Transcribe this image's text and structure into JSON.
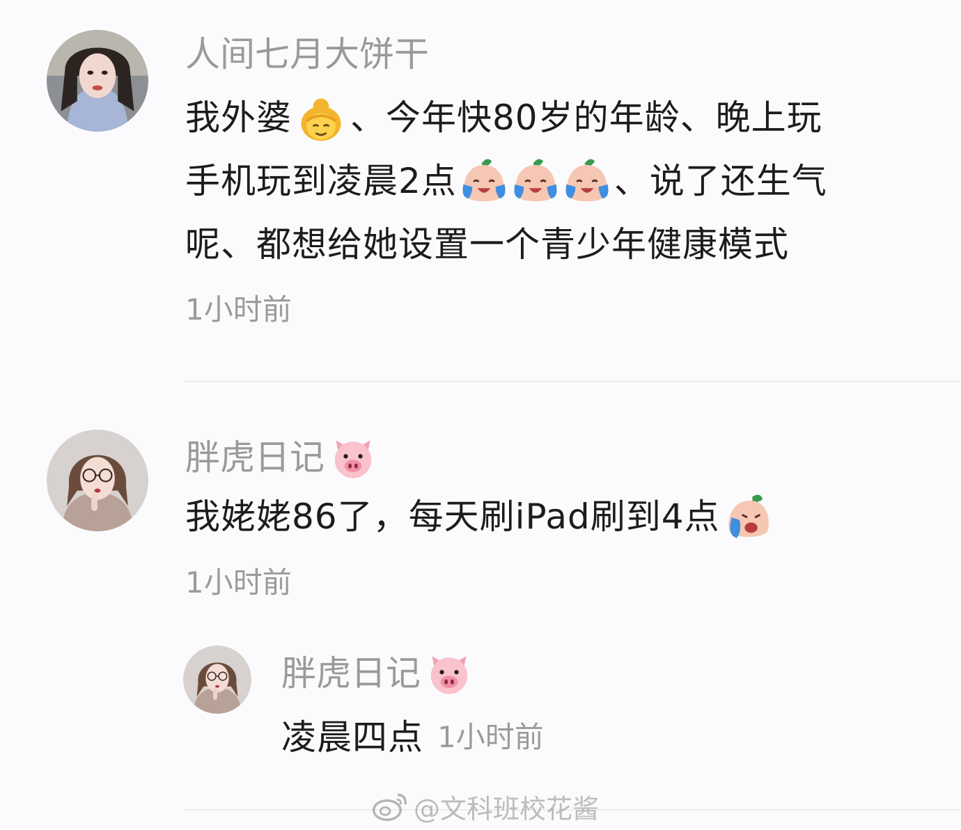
{
  "comments": [
    {
      "username": "人间七月大饼干",
      "lines": [
        [
          "我外婆",
          "、今年快80岁的年龄、晚上玩"
        ],
        [
          "手机玩到凌晨2点",
          "、说了还生气"
        ],
        [
          "呢、都想给她设置一个青少年健康模式"
        ]
      ],
      "time": "1小时前"
    },
    {
      "username": "胖虎日记",
      "text": "我姥姥86了，每天刷iPad刷到4点",
      "time": "1小时前",
      "reply": {
        "username": "胖虎日记",
        "text": "凌晨四点",
        "time": "1小时前"
      }
    }
  ],
  "watermark": "@文科班校花酱",
  "icons": {
    "grandma": "older-woman-emoji",
    "cry": "crying-peach-emoji",
    "pig": "pig-face-emoji",
    "weibo": "weibo-logo-icon"
  },
  "colors": {
    "background": "#fbfbfd",
    "username": "#9a9a9a",
    "text": "#1c1c1c",
    "time": "#9b9b9b",
    "divider": "#ececef"
  }
}
